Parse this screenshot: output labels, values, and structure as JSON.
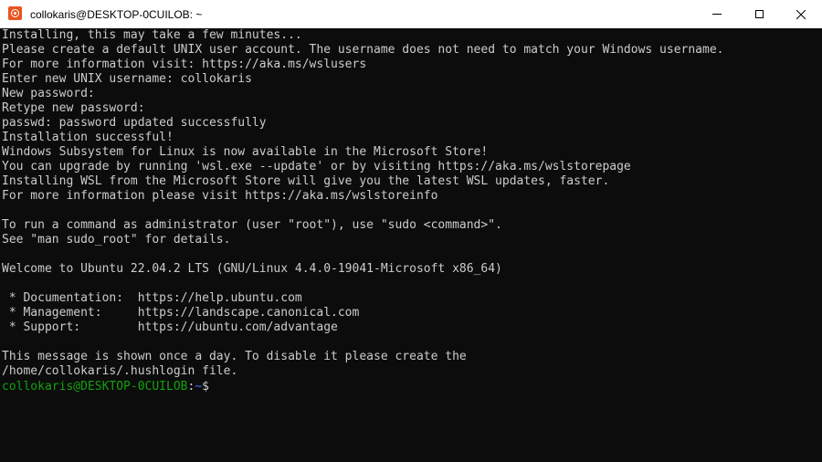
{
  "window": {
    "title": "collokaris@DESKTOP-0CUILOB: ~",
    "app_icon": "ubuntu-icon",
    "controls": {
      "minimize_icon": "minimize-icon",
      "maximize_icon": "maximize-icon",
      "close_icon": "close-icon"
    }
  },
  "colors": {
    "background": "#0c0c0c",
    "text": "#cccccc",
    "prompt_user": "#13a10e",
    "prompt_path": "#3b78ff",
    "titlebar": "#ffffff",
    "ubuntu_orange": "#e95420"
  },
  "terminal": {
    "lines": [
      "Installing, this may take a few minutes...",
      "Please create a default UNIX user account. The username does not need to match your Windows username.",
      "For more information visit: https://aka.ms/wslusers",
      "Enter new UNIX username: collokaris",
      "New password:",
      "Retype new password:",
      "passwd: password updated successfully",
      "Installation successful!",
      "Windows Subsystem for Linux is now available in the Microsoft Store!",
      "You can upgrade by running 'wsl.exe --update' or by visiting https://aka.ms/wslstorepage",
      "Installing WSL from the Microsoft Store will give you the latest WSL updates, faster.",
      "For more information please visit https://aka.ms/wslstoreinfo",
      "",
      "To run a command as administrator (user \"root\"), use \"sudo <command>\".",
      "See \"man sudo_root\" for details.",
      "",
      "Welcome to Ubuntu 22.04.2 LTS (GNU/Linux 4.4.0-19041-Microsoft x86_64)",
      "",
      " * Documentation:  https://help.ubuntu.com",
      " * Management:     https://landscape.canonical.com",
      " * Support:        https://ubuntu.com/advantage",
      "",
      "This message is shown once a day. To disable it please create the",
      "/home/collokaris/.hushlogin file."
    ],
    "prompt": {
      "user_host": "collokaris@DESKTOP-0CUILOB",
      "separator": ":",
      "path": "~",
      "symbol": "$"
    }
  }
}
